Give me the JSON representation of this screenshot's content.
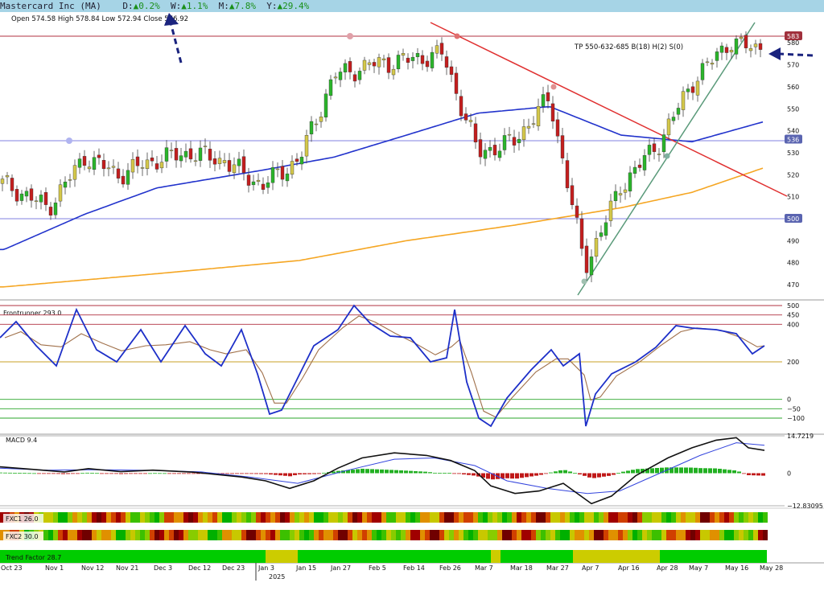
{
  "header": {
    "title": "Mastercard Inc (MA)",
    "d_label": "D:",
    "d_value": "▲0.2%",
    "w_label": "W:",
    "w_value": "▲1.1%",
    "m_label": "M:",
    "m_value": "▲7.8%",
    "y_label": "Y:",
    "y_value": "▲29.4%"
  },
  "ohlc_text": "Open 574.58  High 578.84  Low 572.94  Close 576.92",
  "annotation": "TP 550-632-685 B(18) H(2) S(0)",
  "price_axis": {
    "ticks": [
      "470",
      "480",
      "490",
      "500",
      "510",
      "520",
      "530",
      "540",
      "550",
      "560",
      "570",
      "580"
    ],
    "badges": [
      {
        "text": "583",
        "color": "#a0303c"
      },
      {
        "text": "536",
        "color": "#5a64b0"
      },
      {
        "text": "500",
        "color": "#5a64b0"
      }
    ]
  },
  "frontrunner": {
    "label": "Frontrunner 293.0",
    "ticks": [
      "500",
      "450",
      "400",
      "200",
      "0",
      "−50",
      "−100"
    ]
  },
  "macd": {
    "label": "MACD 9.4",
    "ticks": [
      "14.7219",
      "0",
      "−12.83095"
    ]
  },
  "fxc1": {
    "label": "FXC1 26.0"
  },
  "fxc2": {
    "label": "FXC2 30.0"
  },
  "trend": {
    "label": "Trend Factor 28.7"
  },
  "x_axis": {
    "labels": [
      "Oct 23",
      "Nov 1",
      "Nov 12",
      "Nov 21",
      "Dec 3",
      "Dec 12",
      "Dec 23",
      "Jan 3",
      "Jan 15",
      "Jan 27",
      "Feb 5",
      "Feb 14",
      "Feb 26",
      "Mar 7",
      "Mar 18",
      "Mar 27",
      "Apr 7",
      "Apr 16",
      "Apr 28",
      "May 7",
      "May 16",
      "May 28"
    ],
    "year": "2025"
  },
  "chart_data": {
    "type": "candlestick",
    "title": "Mastercard Inc (MA)",
    "ylim": [
      465,
      588
    ],
    "horizontal_levels": [
      583,
      536,
      500
    ],
    "ohlc_last": {
      "open": 574.58,
      "high": 578.84,
      "low": 572.94,
      "close": 576.92
    },
    "close_series": [
      {
        "date": "Oct 23",
        "close": 516
      },
      {
        "date": "Nov 1",
        "close": 505
      },
      {
        "date": "Nov 12",
        "close": 528
      },
      {
        "date": "Nov 21",
        "close": 520
      },
      {
        "date": "Dec 3",
        "close": 527
      },
      {
        "date": "Dec 12",
        "close": 530
      },
      {
        "date": "Dec 23",
        "close": 526
      },
      {
        "date": "Jan 3",
        "close": 515
      },
      {
        "date": "Jan 15",
        "close": 527
      },
      {
        "date": "Jan 27",
        "close": 565
      },
      {
        "date": "Feb 5",
        "close": 570
      },
      {
        "date": "Feb 14",
        "close": 572
      },
      {
        "date": "Feb 26",
        "close": 575
      },
      {
        "date": "Mar 7",
        "close": 530
      },
      {
        "date": "Mar 18",
        "close": 535
      },
      {
        "date": "Mar 27",
        "close": 555
      },
      {
        "date": "Apr 7",
        "close": 478
      },
      {
        "date": "Apr 16",
        "close": 515
      },
      {
        "date": "Apr 28",
        "close": 535
      },
      {
        "date": "May 7",
        "close": 562
      },
      {
        "date": "May 16",
        "close": 580
      },
      {
        "date": "May 28",
        "close": 576.92
      }
    ],
    "ma50": [
      {
        "date": "Oct 23",
        "v": 486
      },
      {
        "date": "Nov 12",
        "v": 502
      },
      {
        "date": "Dec 3",
        "v": 514
      },
      {
        "date": "Jan 3",
        "v": 522
      },
      {
        "date": "Jan 27",
        "v": 528
      },
      {
        "date": "Feb 14",
        "v": 538
      },
      {
        "date": "Mar 7",
        "v": 548
      },
      {
        "date": "Mar 27",
        "v": 551
      },
      {
        "date": "Apr 16",
        "v": 538
      },
      {
        "date": "May 7",
        "v": 535
      },
      {
        "date": "May 28",
        "v": 544
      }
    ],
    "ma200": [
      {
        "date": "Oct 23",
        "v": 469
      },
      {
        "date": "Dec 3",
        "v": 475
      },
      {
        "date": "Jan 15",
        "v": 481
      },
      {
        "date": "Feb 14",
        "v": 490
      },
      {
        "date": "Mar 18",
        "v": 497
      },
      {
        "date": "Apr 16",
        "v": 505
      },
      {
        "date": "May 7",
        "v": 512
      },
      {
        "date": "May 28",
        "v": 523
      }
    ],
    "frontrunner_range": [
      -120,
      510
    ],
    "macd_range": [
      -12.83095,
      14.7219
    ]
  },
  "colors": {
    "bull": "#2bb52b",
    "bear": "#c41e1e",
    "neutral": "#d4c84a",
    "ma50": "#2233cc",
    "ma200": "#f5a623",
    "trend_green": "#00cc00",
    "trend_yellow": "#cccc00"
  }
}
